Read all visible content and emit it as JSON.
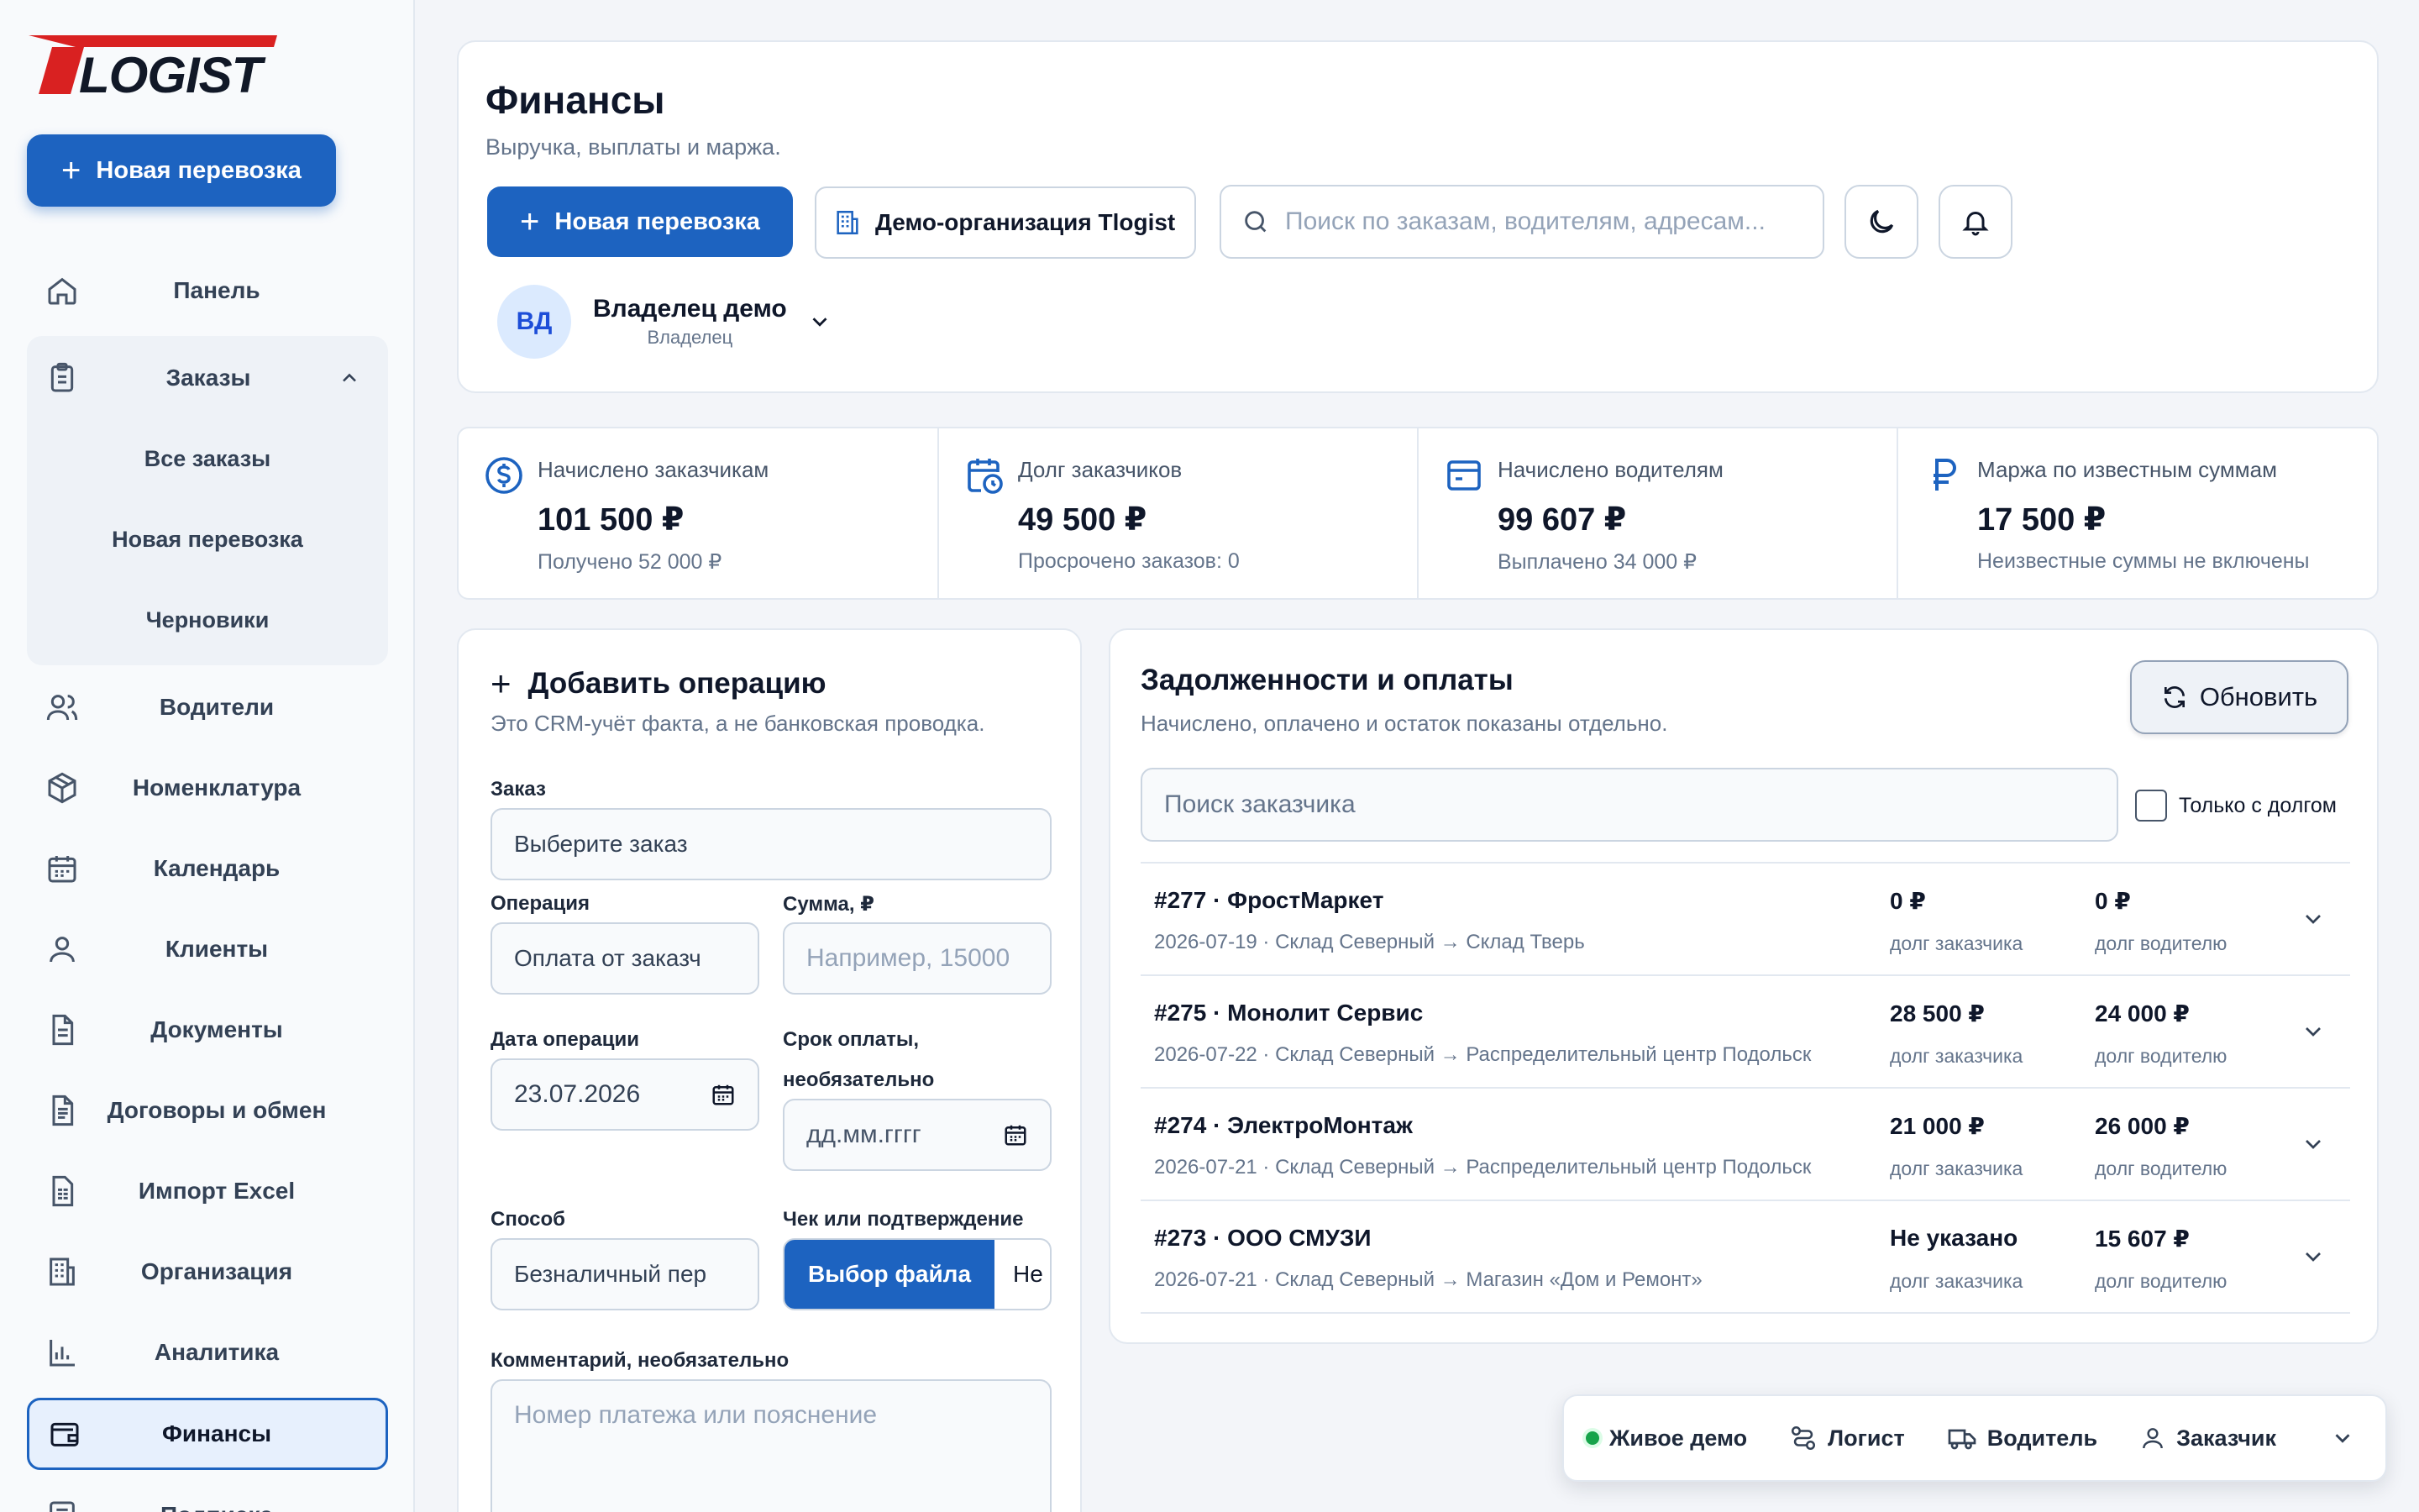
{
  "app": {
    "logo_text": "TLOGIST",
    "new_shipment_label": "Новая перевозка"
  },
  "sidebar": {
    "items": [
      {
        "label": "Панель",
        "icon": "home-icon"
      },
      {
        "label": "Заказы",
        "icon": "clipboard-icon"
      },
      {
        "label": "Водители",
        "icon": "users-icon"
      },
      {
        "label": "Номенклатура",
        "icon": "package-icon"
      },
      {
        "label": "Календарь",
        "icon": "calendar-icon"
      },
      {
        "label": "Клиенты",
        "icon": "user-icon"
      },
      {
        "label": "Документы",
        "icon": "document-icon"
      },
      {
        "label": "Договоры и обмен",
        "icon": "contract-icon"
      },
      {
        "label": "Импорт Excel",
        "icon": "spreadsheet-icon"
      },
      {
        "label": "Организация",
        "icon": "building-icon"
      },
      {
        "label": "Аналитика",
        "icon": "chart-icon"
      },
      {
        "label": "Финансы",
        "icon": "wallet-icon"
      },
      {
        "label": "Подписка",
        "icon": "subscription-icon"
      }
    ],
    "orders_sub": [
      "Все заказы",
      "Новая перевозка",
      "Черновики"
    ]
  },
  "header": {
    "title": "Финансы",
    "subtitle": "Выручка, выплаты и маржа.",
    "new_shipment_label": "Новая перевозка",
    "org_label": "Демо-организация Tlogist",
    "search_placeholder": "Поиск по заказам, водителям, адресам...",
    "user_initials": "ВД",
    "user_name": "Владелец демо",
    "user_role": "Владелец"
  },
  "stats": [
    {
      "label": "Начислено заказчикам",
      "value": "101 500 ₽",
      "sub": "Получено 52 000 ₽",
      "icon": "dollar-circle-icon"
    },
    {
      "label": "Долг заказчиков",
      "value": "49 500 ₽",
      "sub": "Просрочено заказов: 0",
      "icon": "calendar-clock-icon"
    },
    {
      "label": "Начислено водителям",
      "value": "99 607 ₽",
      "sub": "Выплачено 34 000 ₽",
      "icon": "wallet-card-icon"
    },
    {
      "label": "Маржа по известным суммам",
      "value": "17 500 ₽",
      "sub": "Неизвестные суммы не включены",
      "icon": "ruble-icon"
    }
  ],
  "add_operation": {
    "title": "Добавить операцию",
    "subtitle": "Это CRM-учёт факта, а не банковская проводка.",
    "order_label": "Заказ",
    "order_value": "Выберите заказ",
    "operation_label": "Операция",
    "operation_value": "Оплата от заказч",
    "amount_label": "Сумма, ₽",
    "amount_placeholder": "Например, 15000",
    "date_label": "Дата операции",
    "date_value": "23.07.2026",
    "due_label_1": "Срок оплаты,",
    "due_label_2": "необязательно",
    "due_placeholder": "дд.мм.гггг",
    "method_label": "Способ",
    "method_value": "Безналичный пер",
    "receipt_label": "Чек или подтверждение",
    "file_button": "Выбор файла",
    "file_status": "Не",
    "comment_label": "Комментарий, необязательно",
    "comment_placeholder": "Номер платежа или пояснение"
  },
  "debts": {
    "title": "Задолженности и оплаты",
    "subtitle": "Начислено, оплачено и остаток показаны отдельно.",
    "refresh_label": "Обновить",
    "search_placeholder": "Поиск заказчика",
    "only_debt_label": "Только с долгом",
    "only_debt_checked": false,
    "rows": [
      {
        "title": "#277 · ФростМаркет",
        "sub": "2026-07-19 · Склад Северный → Склад Тверь",
        "client_amt": "0 ₽",
        "client_label": "долг заказчика",
        "driver_amt": "0 ₽",
        "driver_label": "долг водителю"
      },
      {
        "title": "#275 · Монолит Сервис",
        "sub": "2026-07-22 · Склад Северный → Распределительный центр Подольск",
        "client_amt": "28 500 ₽",
        "client_label": "долг заказчика",
        "driver_amt": "24 000 ₽",
        "driver_label": "долг водителю"
      },
      {
        "title": "#274 · ЭлектроМонтаж",
        "sub": "2026-07-21 · Склад Северный → Распределительный центр Подольск",
        "client_amt": "21 000 ₽",
        "client_label": "долг заказчика",
        "driver_amt": "26 000 ₽",
        "driver_label": "долг водителю"
      },
      {
        "title": "#273 · ООО СМУЗИ",
        "sub": "2026-07-21 · Склад Северный → Магазин «Дом и Ремонт»",
        "client_amt": "Не указано",
        "client_label": "долг заказчика",
        "driver_amt": "15 607 ₽",
        "driver_label": "долг водителю"
      }
    ]
  },
  "demo_bar": {
    "live_label": "Живое демо",
    "roles": [
      "Логист",
      "Водитель",
      "Заказчик"
    ]
  },
  "colors": {
    "accent": "#1d63c0",
    "live_dot": "#16a34a",
    "brand_red": "#d92121"
  }
}
